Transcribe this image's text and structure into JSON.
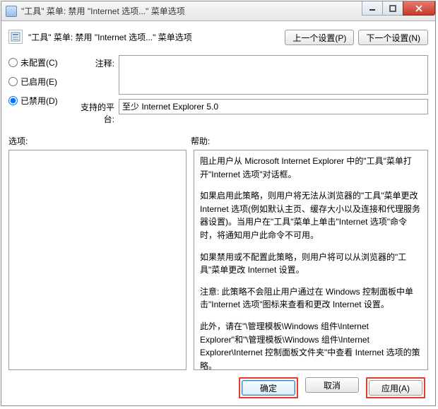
{
  "window": {
    "title": "\"工具\" 菜单: 禁用 \"Internet 选项...\" 菜单选项"
  },
  "header": {
    "policy_title": "\"工具\" 菜单: 禁用 \"Internet 选项...\" 菜单选项",
    "prev_setting": "上一个设置(P)",
    "next_setting": "下一个设置(N)"
  },
  "radio": {
    "not_configured": "未配置(C)",
    "enabled": "已启用(E)",
    "disabled": "已禁用(D)",
    "selected": "disabled"
  },
  "labels": {
    "comment": "注释:",
    "platform": "支持的平台:",
    "options": "选项:",
    "help": "帮助:"
  },
  "fields": {
    "comment_value": "",
    "platform_value": "至少 Internet Explorer 5.0"
  },
  "help": {
    "p1": "阻止用户从 Microsoft Internet Explorer 中的\"工具\"菜单打开\"Internet 选项\"对话框。",
    "p2": "如果启用此策略，则用户将无法从浏览器的\"工具\"菜单更改 Internet 选项(例如默认主页、缓存大小以及连接和代理服务器设置)。当用户在\"工具\"菜单上单击\"Internet 选项\"命令时，将通知用户此命令不可用。",
    "p3": "如果禁用或不配置此策略，则用户将可以从浏览器的\"工具\"菜单更改 Internet 设置。",
    "p4": "注意: 此策略不会阻止用户通过在 Windows 控制面板中单击\"Internet 选项\"图标来查看和更改 Internet 设置。",
    "p5": "此外，请在\"\\管理模板\\Windows 组件\\Internet Explorer\"和\"\\管理模板\\Windows 组件\\Internet Explorer\\Internet 控制面板文件夹\"中查看 Internet 选项的策略。"
  },
  "footer": {
    "ok": "确定",
    "cancel": "取消",
    "apply": "应用(A)"
  }
}
